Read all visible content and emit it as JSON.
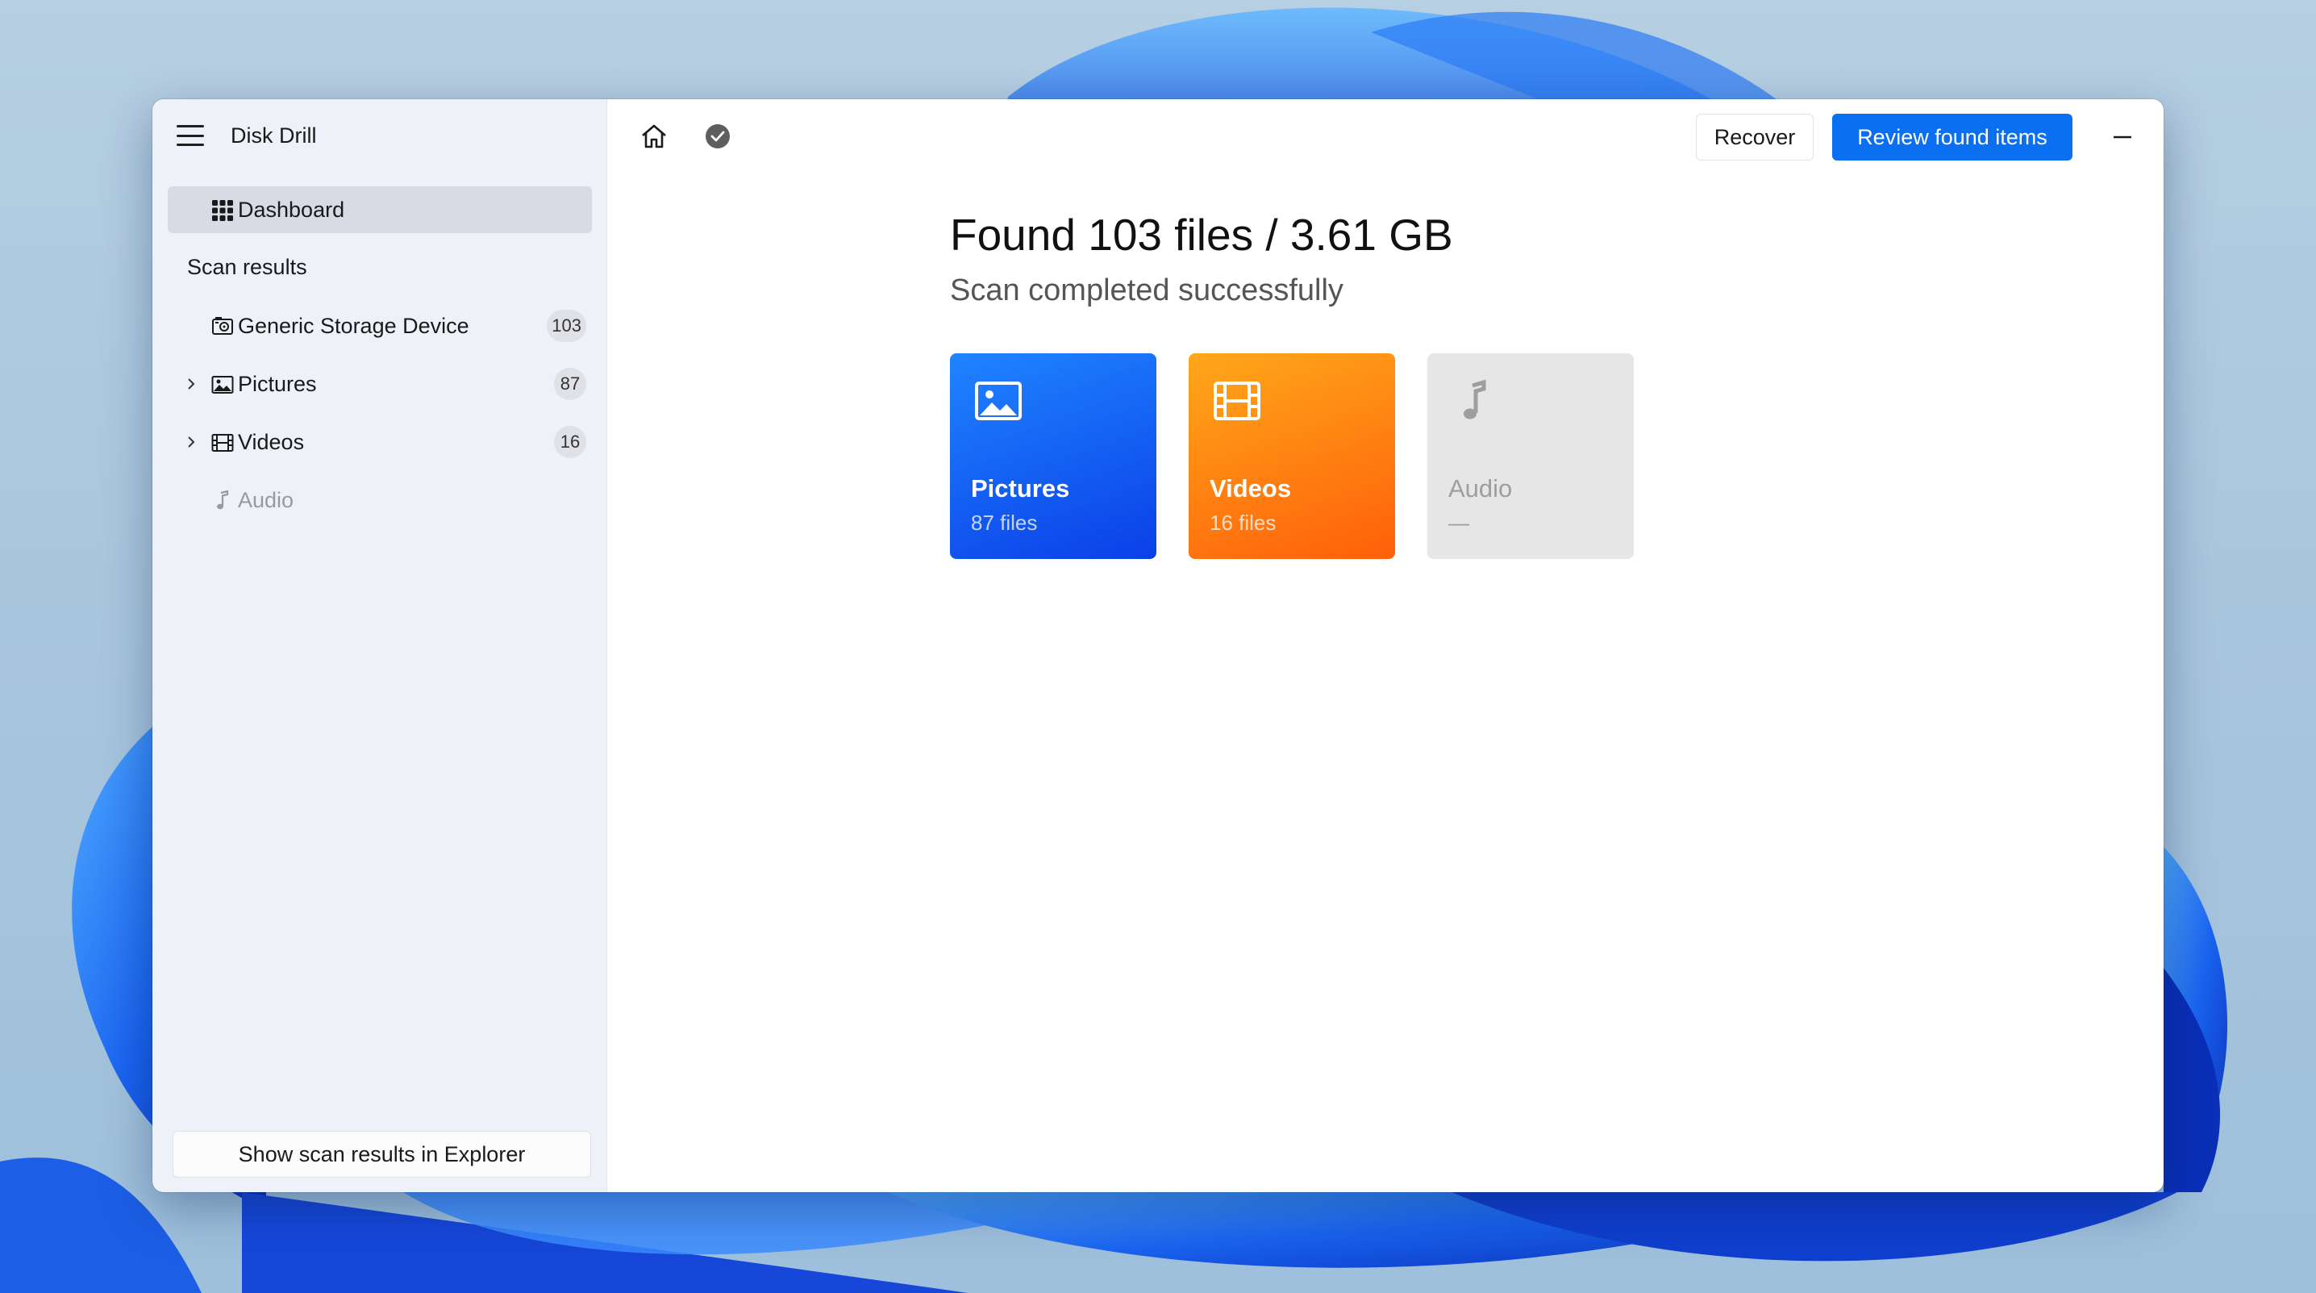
{
  "app": {
    "title": "Disk Drill"
  },
  "sidebar": {
    "dashboard": {
      "label": "Dashboard",
      "icon": "grid-icon"
    },
    "section_heading": "Scan results",
    "items": [
      {
        "label": "Generic Storage Device",
        "count": "103",
        "icon": "storage-device-icon"
      },
      {
        "label": "Pictures",
        "count": "87",
        "icon": "picture-icon"
      },
      {
        "label": "Videos",
        "count": "16",
        "icon": "film-icon"
      },
      {
        "label": "Audio",
        "icon": "music-note-icon"
      }
    ],
    "explorer_button": "Show scan results in Explorer"
  },
  "toolbar": {
    "recover_label": "Recover",
    "review_label": "Review found items"
  },
  "summary": {
    "headline": "Found 103 files / 3.61 GB",
    "status": "Scan completed successfully"
  },
  "tiles": [
    {
      "name": "Pictures",
      "sub": "87 files"
    },
    {
      "name": "Videos",
      "sub": "16 files"
    },
    {
      "name": "Audio",
      "sub": "—"
    }
  ],
  "colors": {
    "accent": "#0b6ff2",
    "pictures_tile": "#1f85ff",
    "videos_tile": "#ff8a12",
    "audio_tile": "#e6e6e6"
  }
}
